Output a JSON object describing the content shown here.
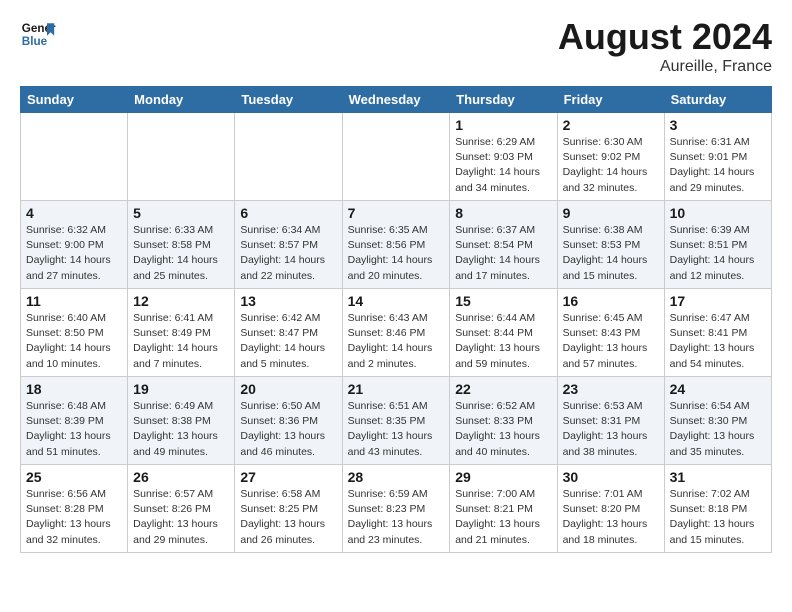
{
  "header": {
    "logo": {
      "line1": "General",
      "line2": "Blue"
    },
    "title": "August 2024",
    "subtitle": "Aureille, France"
  },
  "weekdays": [
    "Sunday",
    "Monday",
    "Tuesday",
    "Wednesday",
    "Thursday",
    "Friday",
    "Saturday"
  ],
  "weeks": [
    [
      {
        "day": "",
        "info": ""
      },
      {
        "day": "",
        "info": ""
      },
      {
        "day": "",
        "info": ""
      },
      {
        "day": "",
        "info": ""
      },
      {
        "day": "1",
        "info": "Sunrise: 6:29 AM\nSunset: 9:03 PM\nDaylight: 14 hours\nand 34 minutes."
      },
      {
        "day": "2",
        "info": "Sunrise: 6:30 AM\nSunset: 9:02 PM\nDaylight: 14 hours\nand 32 minutes."
      },
      {
        "day": "3",
        "info": "Sunrise: 6:31 AM\nSunset: 9:01 PM\nDaylight: 14 hours\nand 29 minutes."
      }
    ],
    [
      {
        "day": "4",
        "info": "Sunrise: 6:32 AM\nSunset: 9:00 PM\nDaylight: 14 hours\nand 27 minutes."
      },
      {
        "day": "5",
        "info": "Sunrise: 6:33 AM\nSunset: 8:58 PM\nDaylight: 14 hours\nand 25 minutes."
      },
      {
        "day": "6",
        "info": "Sunrise: 6:34 AM\nSunset: 8:57 PM\nDaylight: 14 hours\nand 22 minutes."
      },
      {
        "day": "7",
        "info": "Sunrise: 6:35 AM\nSunset: 8:56 PM\nDaylight: 14 hours\nand 20 minutes."
      },
      {
        "day": "8",
        "info": "Sunrise: 6:37 AM\nSunset: 8:54 PM\nDaylight: 14 hours\nand 17 minutes."
      },
      {
        "day": "9",
        "info": "Sunrise: 6:38 AM\nSunset: 8:53 PM\nDaylight: 14 hours\nand 15 minutes."
      },
      {
        "day": "10",
        "info": "Sunrise: 6:39 AM\nSunset: 8:51 PM\nDaylight: 14 hours\nand 12 minutes."
      }
    ],
    [
      {
        "day": "11",
        "info": "Sunrise: 6:40 AM\nSunset: 8:50 PM\nDaylight: 14 hours\nand 10 minutes."
      },
      {
        "day": "12",
        "info": "Sunrise: 6:41 AM\nSunset: 8:49 PM\nDaylight: 14 hours\nand 7 minutes."
      },
      {
        "day": "13",
        "info": "Sunrise: 6:42 AM\nSunset: 8:47 PM\nDaylight: 14 hours\nand 5 minutes."
      },
      {
        "day": "14",
        "info": "Sunrise: 6:43 AM\nSunset: 8:46 PM\nDaylight: 14 hours\nand 2 minutes."
      },
      {
        "day": "15",
        "info": "Sunrise: 6:44 AM\nSunset: 8:44 PM\nDaylight: 13 hours\nand 59 minutes."
      },
      {
        "day": "16",
        "info": "Sunrise: 6:45 AM\nSunset: 8:43 PM\nDaylight: 13 hours\nand 57 minutes."
      },
      {
        "day": "17",
        "info": "Sunrise: 6:47 AM\nSunset: 8:41 PM\nDaylight: 13 hours\nand 54 minutes."
      }
    ],
    [
      {
        "day": "18",
        "info": "Sunrise: 6:48 AM\nSunset: 8:39 PM\nDaylight: 13 hours\nand 51 minutes."
      },
      {
        "day": "19",
        "info": "Sunrise: 6:49 AM\nSunset: 8:38 PM\nDaylight: 13 hours\nand 49 minutes."
      },
      {
        "day": "20",
        "info": "Sunrise: 6:50 AM\nSunset: 8:36 PM\nDaylight: 13 hours\nand 46 minutes."
      },
      {
        "day": "21",
        "info": "Sunrise: 6:51 AM\nSunset: 8:35 PM\nDaylight: 13 hours\nand 43 minutes."
      },
      {
        "day": "22",
        "info": "Sunrise: 6:52 AM\nSunset: 8:33 PM\nDaylight: 13 hours\nand 40 minutes."
      },
      {
        "day": "23",
        "info": "Sunrise: 6:53 AM\nSunset: 8:31 PM\nDaylight: 13 hours\nand 38 minutes."
      },
      {
        "day": "24",
        "info": "Sunrise: 6:54 AM\nSunset: 8:30 PM\nDaylight: 13 hours\nand 35 minutes."
      }
    ],
    [
      {
        "day": "25",
        "info": "Sunrise: 6:56 AM\nSunset: 8:28 PM\nDaylight: 13 hours\nand 32 minutes."
      },
      {
        "day": "26",
        "info": "Sunrise: 6:57 AM\nSunset: 8:26 PM\nDaylight: 13 hours\nand 29 minutes."
      },
      {
        "day": "27",
        "info": "Sunrise: 6:58 AM\nSunset: 8:25 PM\nDaylight: 13 hours\nand 26 minutes."
      },
      {
        "day": "28",
        "info": "Sunrise: 6:59 AM\nSunset: 8:23 PM\nDaylight: 13 hours\nand 23 minutes."
      },
      {
        "day": "29",
        "info": "Sunrise: 7:00 AM\nSunset: 8:21 PM\nDaylight: 13 hours\nand 21 minutes."
      },
      {
        "day": "30",
        "info": "Sunrise: 7:01 AM\nSunset: 8:20 PM\nDaylight: 13 hours\nand 18 minutes."
      },
      {
        "day": "31",
        "info": "Sunrise: 7:02 AM\nSunset: 8:18 PM\nDaylight: 13 hours\nand 15 minutes."
      }
    ]
  ]
}
